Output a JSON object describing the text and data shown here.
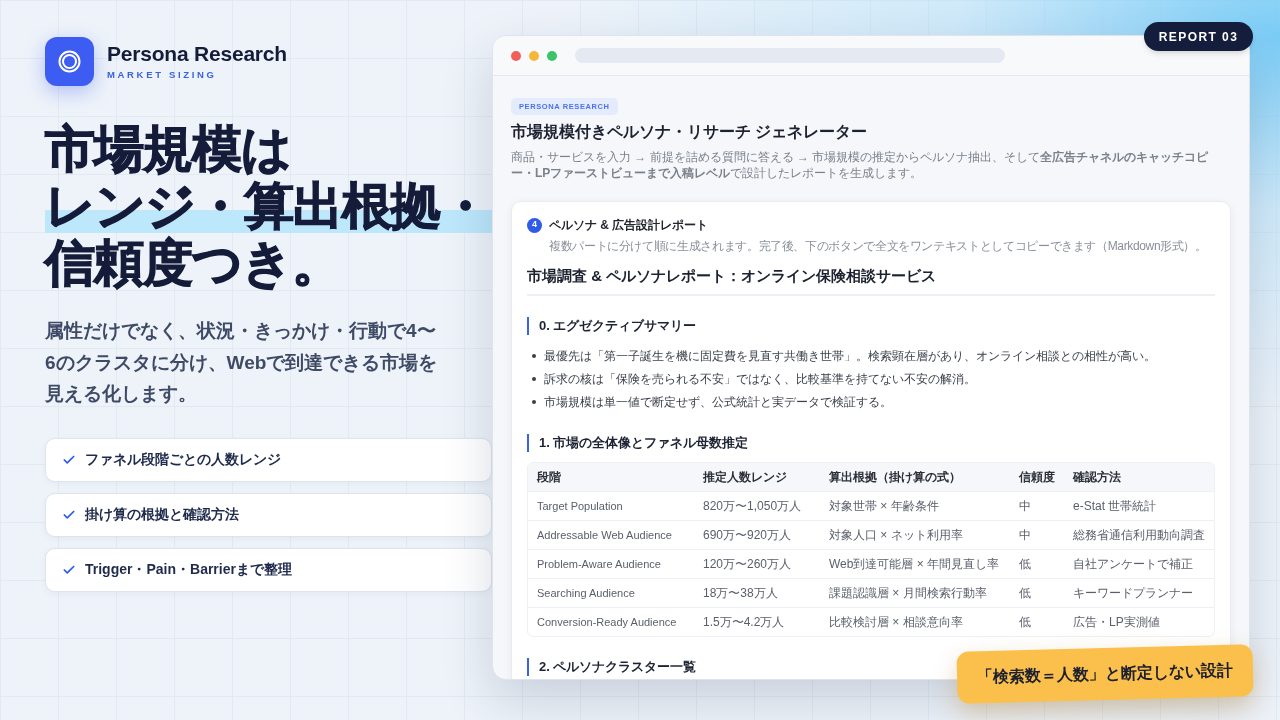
{
  "brand": {
    "name": "Persona Research",
    "tagline": "MARKET SIZING"
  },
  "headline": {
    "lines": [
      {
        "text": "市場規模は",
        "highlighted": false
      },
      {
        "text": "レンジ・算出根拠・",
        "highlighted": true
      },
      {
        "text": "信頼度つき。",
        "highlighted": false
      }
    ]
  },
  "description": "属性だけでなく、状況・きっかけ・行動で4〜6のクラスタに分け、Webで到達できる市場を見える化します。",
  "features": [
    {
      "label": "ファネル段階ごとの人数レンジ"
    },
    {
      "label": "掛け算の根拠と確認方法"
    },
    {
      "label": "Trigger・Pain・Barrierまで整理"
    }
  ],
  "report_badge": "REPORT 03",
  "browser": {
    "tag": "PERSONA RESEARCH",
    "title": "市場規模付きペルソナ・リサーチ ジェネレーター",
    "intro": "商品・サービスを入力 → 前提を詰める質問に答える → 市場規模の推定からペルソナ抽出、そして**全広告チャネルのキャッチコピー・LPファーストビューまで入稿レベル**で設計したレポートを生成します。",
    "step": {
      "number": "4",
      "title": "ペルソナ & 広告設計レポート",
      "subtitle": "複数パートに分けて順に生成されます。完了後、下のボタンで全文をワンテキストとしてコピーできます（Markdown形式）。"
    },
    "report": {
      "title": "市場調査 & ペルソナレポート：オンライン保険相談サービス",
      "sections": [
        {
          "kind": "bullets",
          "heading": "0. エグゼクティブサマリー",
          "bullets": [
            "最優先は「第一子誕生を機に固定費を見直す共働き世帯」。検索顕在層があり、オンライン相談との相性が高い。",
            "訴求の核は「保険を売られる不安」ではなく、比較基準を持てない不安の解消。",
            "市場規模は単一値で断定せず、公式統計と実データで検証する。"
          ]
        },
        {
          "kind": "table",
          "heading": "1. 市場の全体像とファネル母数推定",
          "table": {
            "columns": [
              "段階",
              "推定人数レンジ",
              "算出根拠（掛け算の式）",
              "信頼度",
              "確認方法"
            ],
            "rows": [
              [
                "Target Population",
                "820万〜1,050万人",
                "対象世帯 × 年齢条件",
                "中",
                "e-Stat 世帯統計"
              ],
              [
                "Addressable Web Audience",
                "690万〜920万人",
                "対象人口 × ネット利用率",
                "中",
                "総務省通信利用動向調査"
              ],
              [
                "Problem-Aware Audience",
                "120万〜260万人",
                "Web到達可能層 × 年間見直し率",
                "低",
                "自社アンケートで補正"
              ],
              [
                "Searching Audience",
                "18万〜38万人",
                "課題認識層 × 月間検索行動率",
                "低",
                "キーワードプランナー"
              ],
              [
                "Conversion-Ready Audience",
                "1.5万〜4.2万人",
                "比較検討層 × 相談意向率",
                "低",
                "広告・LP実測値"
              ]
            ]
          }
        },
        {
          "kind": "heading",
          "heading": "2. ペルソナクラスター一覧"
        }
      ]
    }
  },
  "callout": "「検索数＝人数」と断定しない設計"
}
